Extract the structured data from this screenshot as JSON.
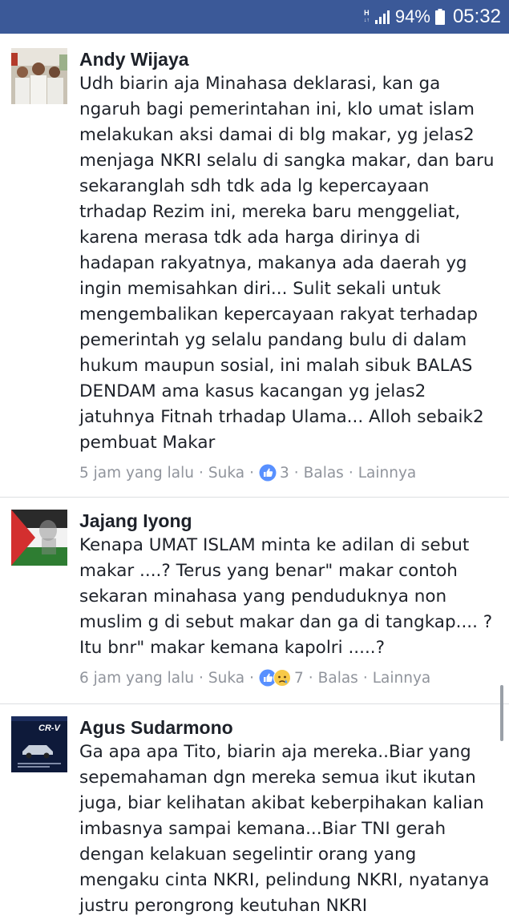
{
  "status_bar": {
    "network_top": "H",
    "network_arrows": "↓↑",
    "battery": "94%",
    "time": "05:32"
  },
  "comments": [
    {
      "author": "Andy Wijaya",
      "avatar_icon": "group-photo-avatar",
      "text": "Udh biarin aja Minahasa deklarasi, kan ga\nngaruh bagi pemerintahan ini, klo umat islam\nmelakukan aksi damai di blg makar, yg jelas2\nmenjaga NKRI selalu di sangka makar, dan baru\nsekaranglah sdh tdk ada lg kepercayaan\ntrhadap Rezim ini, mereka baru menggeliat,\nkarena merasa tdk ada harga dirinya di\nhadapan rakyatnya, makanya ada daerah yg\ningin memisahkan diri... Sulit sekali untuk\nmengembalikan kepercayaan rakyat terhadap\npemerintah yg selalu pandang bulu di dalam\nhukum maupun sosial, ini malah sibuk BALAS\nDENDAM ama kasus kacangan yg jelas2\njatuhnya Fitnah trhadap Ulama... Alloh sebaik2\npembuat Makar",
      "time": "5 jam yang lalu",
      "like_label": "Suka",
      "reactions": [
        "like"
      ],
      "reaction_count": "3",
      "reply_label": "Balas",
      "more_label": "Lainnya"
    },
    {
      "author": "Jajang Iyong",
      "avatar_icon": "palestine-flag-avatar",
      "text": "Kenapa UMAT ISLAM minta ke adilan di sebut\nmakar ....? Terus yang benar\" makar contoh\nsekaran minahasa yang penduduknya non\nmuslim g di sebut makar dan ga di tangkap.... ?\nItu bnr\" makar kemana kapolri .....?",
      "time": "6 jam yang lalu",
      "like_label": "Suka",
      "reactions": [
        "like",
        "sad"
      ],
      "reaction_count": "7",
      "reply_label": "Balas",
      "more_label": "Lainnya"
    },
    {
      "author": "Agus Sudarmono",
      "avatar_icon": "car-ad-avatar",
      "avatar_logo": "CR-V",
      "text": "Ga apa apa Tito, biarin aja mereka..Biar yang\nsepemahaman dgn mereka semua ikut ikutan\njuga, biar kelihatan akibat keberpihakan kalian\nimbasnya sampai kemana...Biar TNI gerah\ndengan kelakuan segelintir orang yang\nmengaku cinta NKRI, pelindung NKRI, nyatanya\njustru perongrong keutuhan NKRI"
    }
  ]
}
